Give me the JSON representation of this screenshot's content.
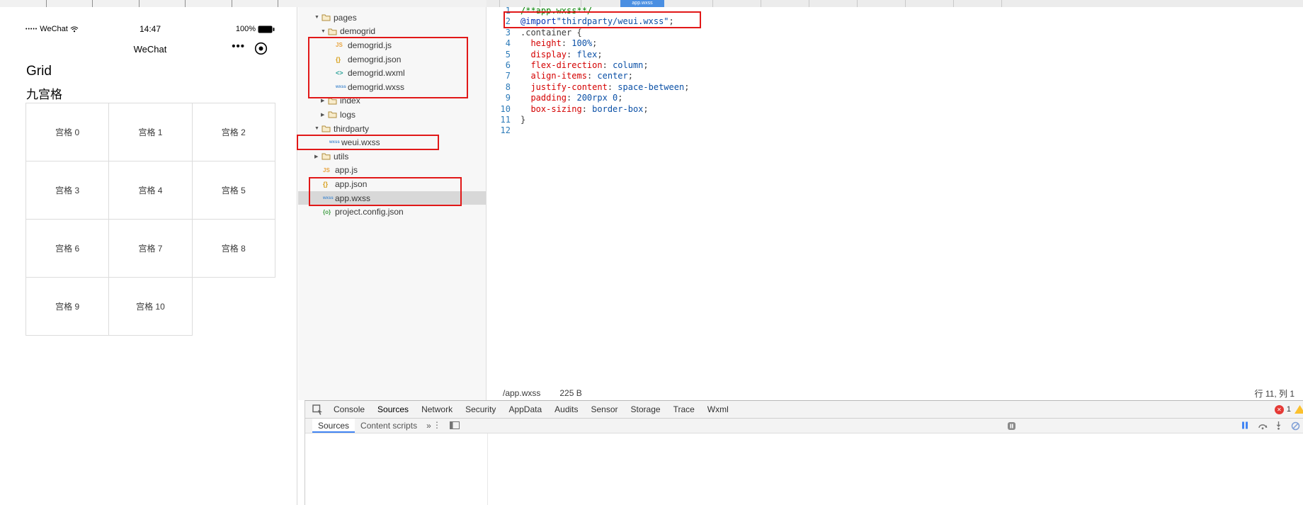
{
  "colors": {
    "annotation_red": "#e11818",
    "active_tab_blue": "#4a8fe2",
    "error_red": "#e53935",
    "warning_yellow": "#fbc02d"
  },
  "simulator": {
    "status_bar": {
      "signal_dots": "•••••",
      "carrier": "WeChat",
      "time": "14:47",
      "battery_percent": "100%"
    },
    "nav_title": "WeChat",
    "more_dots": "•••",
    "page_title": "Grid",
    "page_subtitle": "九宫格",
    "grid_cells": [
      "宫格 0",
      "宫格 1",
      "宫格 2",
      "宫格 3",
      "宫格 4",
      "宫格 5",
      "宫格 6",
      "宫格 7",
      "宫格 8",
      "宫格 9",
      "宫格 10"
    ]
  },
  "file_tree": {
    "items": [
      {
        "label": "pages",
        "type": "folder",
        "indent": 0,
        "arrow": "down"
      },
      {
        "label": "demogrid",
        "type": "folder",
        "indent": 1,
        "arrow": "down"
      },
      {
        "label": "demogrid.js",
        "type": "js",
        "indent": 2
      },
      {
        "label": "demogrid.json",
        "type": "json",
        "indent": 2
      },
      {
        "label": "demogrid.wxml",
        "type": "wxml",
        "indent": 2
      },
      {
        "label": "demogrid.wxss",
        "type": "wxss",
        "indent": 2
      },
      {
        "label": "index",
        "type": "folder",
        "indent": 1,
        "arrow": "right"
      },
      {
        "label": "logs",
        "type": "folder",
        "indent": 1,
        "arrow": "right"
      },
      {
        "label": "thirdparty",
        "type": "folder",
        "indent": 0,
        "arrow": "down"
      },
      {
        "label": "weui.wxss",
        "type": "wxss",
        "indent": 1
      },
      {
        "label": "utils",
        "type": "folder",
        "indent": 0,
        "arrow": "right"
      },
      {
        "label": "app.js",
        "type": "js",
        "indent": 0
      },
      {
        "label": "app.json",
        "type": "json",
        "indent": 0
      },
      {
        "label": "app.wxss",
        "type": "wxss",
        "indent": 0,
        "selected": true
      },
      {
        "label": "project.config.json",
        "type": "config",
        "indent": 0
      }
    ]
  },
  "editor": {
    "active_tab": "app.wxss",
    "lines": [
      {
        "n": 1,
        "tokens": [
          {
            "t": "/**app.wxss**/",
            "c": "comment"
          }
        ]
      },
      {
        "n": 2,
        "tokens": [
          {
            "t": "@import",
            "c": "keyword"
          },
          {
            "t": "\"thirdparty/weui.wxss\"",
            "c": "string"
          },
          {
            "t": ";",
            "c": "punct"
          }
        ]
      },
      {
        "n": 3,
        "tokens": [
          {
            "t": ".container",
            "c": "selector"
          },
          {
            "t": " {",
            "c": "punct"
          }
        ]
      },
      {
        "n": 4,
        "tokens": [
          {
            "t": "  ",
            "c": "punct"
          },
          {
            "t": "height",
            "c": "prop"
          },
          {
            "t": ": ",
            "c": "punct"
          },
          {
            "t": "100%",
            "c": "value"
          },
          {
            "t": ";",
            "c": "punct"
          }
        ]
      },
      {
        "n": 5,
        "tokens": [
          {
            "t": "  ",
            "c": "punct"
          },
          {
            "t": "display",
            "c": "prop"
          },
          {
            "t": ": ",
            "c": "punct"
          },
          {
            "t": "flex",
            "c": "value"
          },
          {
            "t": ";",
            "c": "punct"
          }
        ]
      },
      {
        "n": 6,
        "tokens": [
          {
            "t": "  ",
            "c": "punct"
          },
          {
            "t": "flex-direction",
            "c": "prop"
          },
          {
            "t": ": ",
            "c": "punct"
          },
          {
            "t": "column",
            "c": "value"
          },
          {
            "t": ";",
            "c": "punct"
          }
        ]
      },
      {
        "n": 7,
        "tokens": [
          {
            "t": "  ",
            "c": "punct"
          },
          {
            "t": "align-items",
            "c": "prop"
          },
          {
            "t": ": ",
            "c": "punct"
          },
          {
            "t": "center",
            "c": "value"
          },
          {
            "t": ";",
            "c": "punct"
          }
        ]
      },
      {
        "n": 8,
        "tokens": [
          {
            "t": "  ",
            "c": "punct"
          },
          {
            "t": "justify-content",
            "c": "prop"
          },
          {
            "t": ": ",
            "c": "punct"
          },
          {
            "t": "space-between",
            "c": "value"
          },
          {
            "t": ";",
            "c": "punct"
          }
        ]
      },
      {
        "n": 9,
        "tokens": [
          {
            "t": "  ",
            "c": "punct"
          },
          {
            "t": "padding",
            "c": "prop"
          },
          {
            "t": ": ",
            "c": "punct"
          },
          {
            "t": "200rpx 0",
            "c": "value"
          },
          {
            "t": ";",
            "c": "punct"
          }
        ]
      },
      {
        "n": 10,
        "tokens": [
          {
            "t": "  ",
            "c": "punct"
          },
          {
            "t": "box-sizing",
            "c": "prop"
          },
          {
            "t": ": ",
            "c": "punct"
          },
          {
            "t": "border-box",
            "c": "value"
          },
          {
            "t": ";",
            "c": "punct"
          }
        ]
      },
      {
        "n": 11,
        "tokens": [
          {
            "t": "}",
            "c": "punct"
          }
        ]
      },
      {
        "n": 12,
        "tokens": []
      }
    ],
    "status": {
      "path": "/app.wxss",
      "size": "225 B",
      "cursor": "行 11, 列 1"
    }
  },
  "devtools": {
    "tabs": [
      "Console",
      "Sources",
      "Network",
      "Security",
      "AppData",
      "Audits",
      "Sensor",
      "Storage",
      "Trace",
      "Wxml"
    ],
    "active_tab": "Sources",
    "error_count": "1",
    "error_mark": "✕",
    "subtabs": [
      {
        "label": "Sources",
        "active": true
      },
      {
        "label": "Content scripts",
        "active": false
      }
    ],
    "overflow_icon": "»",
    "menu_icon": "⋮"
  }
}
